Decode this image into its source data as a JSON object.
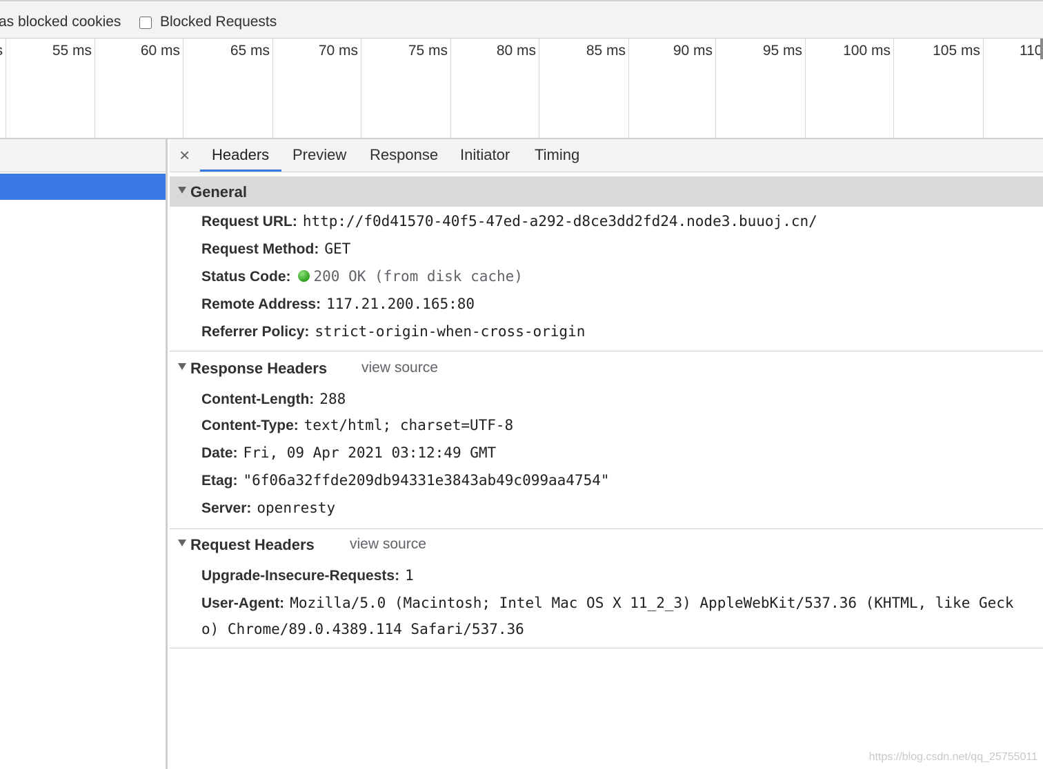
{
  "filters": {
    "blocked_cookies_label": "as blocked cookies",
    "blocked_requests_label": "Blocked Requests",
    "blocked_requests_checked": false
  },
  "timeline": {
    "ticks": [
      "s",
      "55 ms",
      "60 ms",
      "65 ms",
      "70 ms",
      "75 ms",
      "80 ms",
      "85 ms",
      "90 ms",
      "95 ms",
      "100 ms",
      "105 ms",
      "110"
    ]
  },
  "tabs": {
    "close": "×",
    "headers": "Headers",
    "preview": "Preview",
    "response": "Response",
    "initiator": "Initiator",
    "timing": "Timing",
    "active": "Headers"
  },
  "general": {
    "title": "General",
    "request_url_key": "Request URL:",
    "request_url": "http://f0d41570-40f5-47ed-a292-d8ce3dd2fd24.node3.buuoj.cn/",
    "request_method_key": "Request Method:",
    "request_method": "GET",
    "status_code_key": "Status Code:",
    "status_code": "200 OK (from disk cache)",
    "remote_address_key": "Remote Address:",
    "remote_address": "117.21.200.165:80",
    "referrer_policy_key": "Referrer Policy:",
    "referrer_policy": "strict-origin-when-cross-origin"
  },
  "response_headers": {
    "title": "Response Headers",
    "view_source": "view source",
    "content_length_key": "Content-Length:",
    "content_length": "288",
    "content_type_key": "Content-Type:",
    "content_type": "text/html; charset=UTF-8",
    "date_key": "Date:",
    "date": "Fri, 09 Apr 2021 03:12:49 GMT",
    "etag_key": "Etag:",
    "etag": "\"6f06a32ffde209db94331e3843ab49c099aa4754\"",
    "server_key": "Server:",
    "server": "openresty"
  },
  "request_headers": {
    "title": "Request Headers",
    "view_source": "view source",
    "upgrade_key": "Upgrade-Insecure-Requests:",
    "upgrade": "1",
    "user_agent_key": "User-Agent:",
    "user_agent_line1": "Mozilla/5.0 (Macintosh; Intel Mac OS X 11_2_3) AppleWebKit/537.36 (KHTML, like Geck",
    "user_agent_line2": "o) Chrome/89.0.4389.114 Safari/537.36"
  },
  "watermark": "https://blog.csdn.net/qq_25755011",
  "colors": {
    "selection": "#3b78e7",
    "status_ok": "#2f9e1f",
    "header_bg": "#f3f3f3",
    "general_bg": "#d9d9d9"
  }
}
